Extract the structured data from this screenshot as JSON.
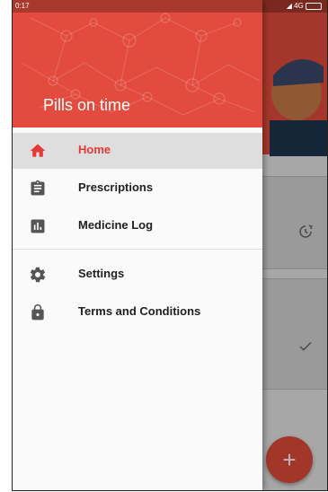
{
  "status_bar": {
    "time": "0:17",
    "network": "4G"
  },
  "drawer": {
    "title": "Pills on time",
    "items": [
      {
        "label": "Home",
        "icon": "home-icon",
        "active": true
      },
      {
        "label": "Prescriptions",
        "icon": "clipboard-icon",
        "active": false
      },
      {
        "label": "Medicine Log",
        "icon": "bar-chart-icon",
        "active": false
      },
      {
        "label": "Settings",
        "icon": "gear-icon",
        "active": false
      },
      {
        "label": "Terms and Conditions",
        "icon": "lock-icon",
        "active": false
      }
    ]
  },
  "background": {
    "fab_label": "+",
    "card_icons": [
      "snooze-icon",
      "check-icon"
    ]
  },
  "colors": {
    "accent": "#e24b3d",
    "active_text": "#e53935",
    "active_bg": "#dedede"
  }
}
